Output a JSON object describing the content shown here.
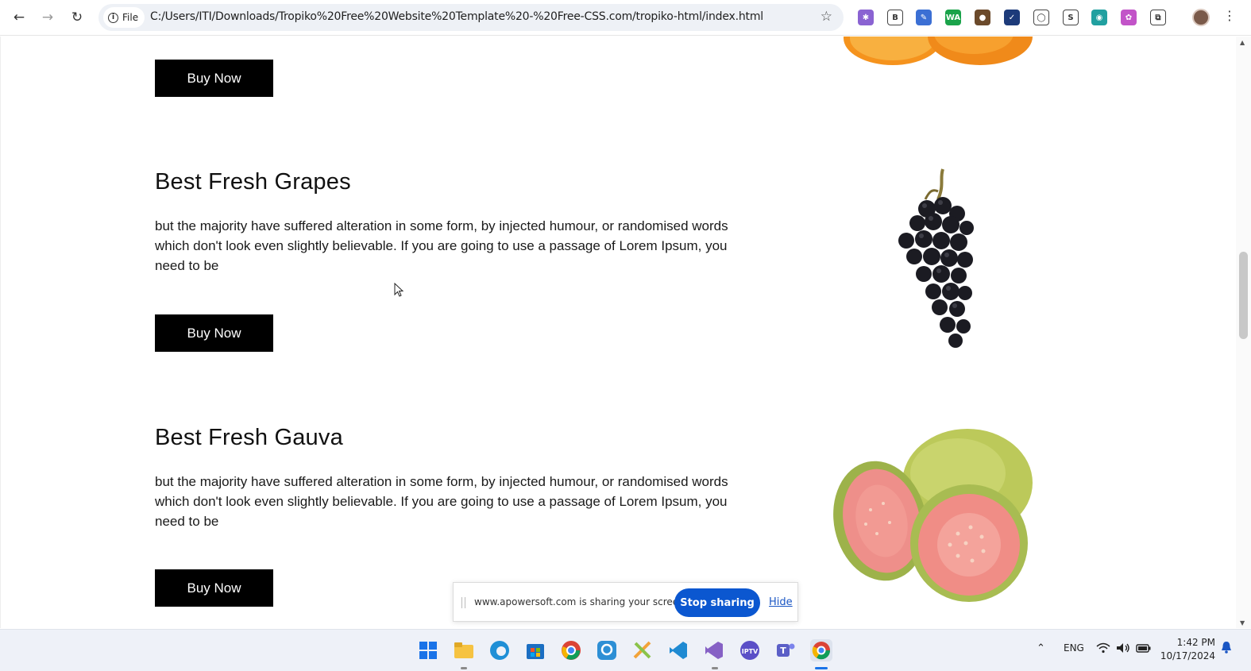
{
  "browser": {
    "file_chip": "File",
    "url": "C:/Users/ITI/Downloads/Tropiko%20Free%20Website%20Template%20-%20Free-CSS.com/tropiko-html/index.html",
    "extensions": [
      {
        "name": "gear-ext",
        "glyph": "✱",
        "color": "#8a63d2"
      },
      {
        "name": "b-ext",
        "glyph": "B",
        "color": "#ffffff"
      },
      {
        "name": "feather-ext",
        "glyph": "✎",
        "color": "#3b6fd4"
      },
      {
        "name": "wa-ext",
        "glyph": "WA",
        "color": "#1aa34a"
      },
      {
        "name": "cookie-ext",
        "glyph": "●",
        "color": "#6b4a2b"
      },
      {
        "name": "check-ext",
        "glyph": "✓",
        "color": "#1d3b7a"
      },
      {
        "name": "ring-ext",
        "glyph": "◯",
        "color": "#ffffff"
      },
      {
        "name": "s-ext",
        "glyph": "S",
        "color": "#ffffff"
      },
      {
        "name": "camera-ext",
        "glyph": "◉",
        "color": "#21a0a0"
      },
      {
        "name": "brain-ext",
        "glyph": "✿",
        "color": "#c254c8"
      },
      {
        "name": "puzzle-ext",
        "glyph": "⧉",
        "color": "#ffffff"
      }
    ]
  },
  "page": {
    "top_button": "Buy Now",
    "products": [
      {
        "title": "Best Fresh Grapes",
        "description": "but the majority have suffered alteration in some form, by injected humour, or randomised words which don't look even slightly believable. If you are going to use a passage of Lorem Ipsum, you need to be",
        "button": "Buy Now"
      },
      {
        "title": "Best Fresh Gauva",
        "description": "but the majority have suffered alteration in some form, by injected humour, or randomised words which don't look even slightly believable. If you are going to use a passage of Lorem Ipsum, you need to be",
        "button": "Buy Now"
      }
    ]
  },
  "share_bar": {
    "message": "www.apowersoft.com is sharing your screen.",
    "stop": "Stop sharing",
    "hide": "Hide"
  },
  "taskbar": {
    "language": "ENG",
    "time": "1:42 PM",
    "date": "10/17/2024"
  }
}
